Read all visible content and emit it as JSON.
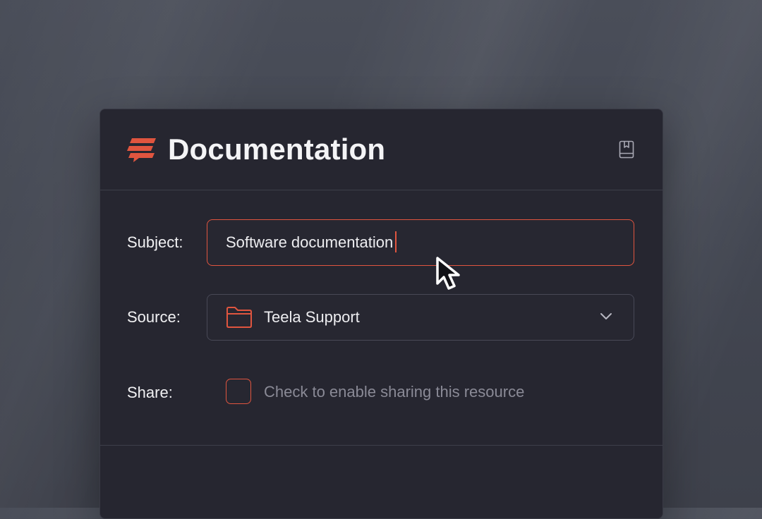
{
  "panel": {
    "title": "Documentation",
    "logo_icon": "brand-logo",
    "header_icon": "book-icon"
  },
  "form": {
    "subject": {
      "label": "Subject:",
      "value": "Software documentation"
    },
    "source": {
      "label": "Source:",
      "value": "Teela Support",
      "icon": "folder-icon",
      "dropdown_icon": "chevron-down-icon"
    },
    "share": {
      "label": "Share:",
      "checked": false,
      "hint": "Check to enable sharing this resource"
    }
  },
  "colors": {
    "accent": "#e0553f",
    "panel_bg": "#262630",
    "background": "#444852",
    "text": "#f1f1f3",
    "muted_text": "#8a8a96"
  }
}
